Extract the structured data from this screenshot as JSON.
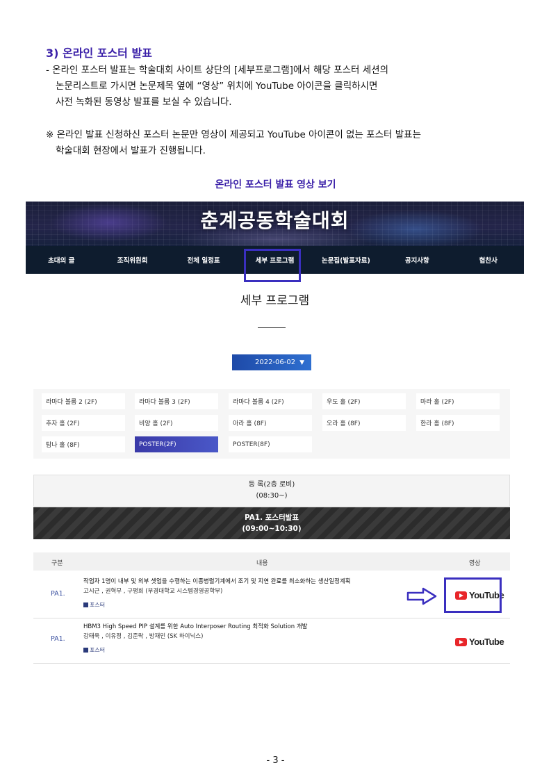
{
  "doc": {
    "heading": "3) 온라인 포스터 발표",
    "bullet_lines": [
      "- 온라인 포스터 발표는 학술대회 사이트 상단의 [세부프로그램]에서 해당 포스터 세션의",
      "논문리스트로 가시면 논문제목 옆에 “영상” 위치에 YouTube 아이콘을 클릭하시면",
      "사전 녹화된 동영상 발표를 보실 수 있습니다."
    ],
    "note_lines": [
      "※ 온라인 발표 신청하신 포스터 논문만 영상이 제공되고 YouTube 아이콘이 없는 포스터 발표는",
      "학술대회 현장에서 발표가 진행됩니다."
    ],
    "sub_heading": "온라인 포스터 발표 영상 보기",
    "page_number": "- 3 -"
  },
  "site": {
    "banner_title": "춘계공동학술대회",
    "nav": [
      "초대의 글",
      "조직위원회",
      "전체 일정표",
      "세부 프로그램",
      "논문집(발표자료)",
      "공지사항",
      "협찬사"
    ],
    "page_title": "세부 프로그램",
    "date_select": "2022-06-02",
    "date_arrow": "▼",
    "rooms": [
      "라마다 볼룸 2 (2F)",
      "라마다 볼룸 3 (2F)",
      "라마다 볼룸 4 (2F)",
      "우도 홀 (2F)",
      "마라 홀 (2F)",
      "추자 홀 (2F)",
      "비양 홀 (2F)",
      "아라 홀 (8F)",
      "오라 홀 (8F)",
      "한라 홀 (8F)",
      "탐나 홀 (8F)",
      "POSTER(2F)",
      "POSTER(8F)"
    ],
    "active_room": "POSTER(2F)",
    "registration": {
      "label": "등 록(2층 로비)",
      "time": "(08:30~)"
    },
    "session": {
      "label": "PA1. 포스터발표",
      "time": "(09:00~10:30)"
    },
    "table_headers": {
      "code": "구분",
      "content": "내용",
      "video": "영상"
    },
    "papers": [
      {
        "code": "PA1.",
        "title": "작업자 1명이 내부 및 외부 셋업을 수행하는 이종병렬기계에서 조기 및 지연 완료를 최소화하는 생산일정계획",
        "authors": "고시근 , 권혁무 , 구평회 (부경대학교 시스템경영공학부)",
        "poster_label": "포스터",
        "video_label": "YouTube"
      },
      {
        "code": "PA1.",
        "title": "HBM3 High Speed PIP 설계를 위한 Auto Interposer Routing 최적화 Solution 개발",
        "authors": "강태욱 , 이유정 , 김준락 , 방재민 (SK 하이닉스)",
        "poster_label": "포스터",
        "video_label": "YouTube"
      }
    ]
  },
  "colors": {
    "accent": "#3a1fa8",
    "highlight_box": "#3a2fbf",
    "youtube_red": "#e8262a",
    "nav_bg": "#0e1c2e"
  }
}
